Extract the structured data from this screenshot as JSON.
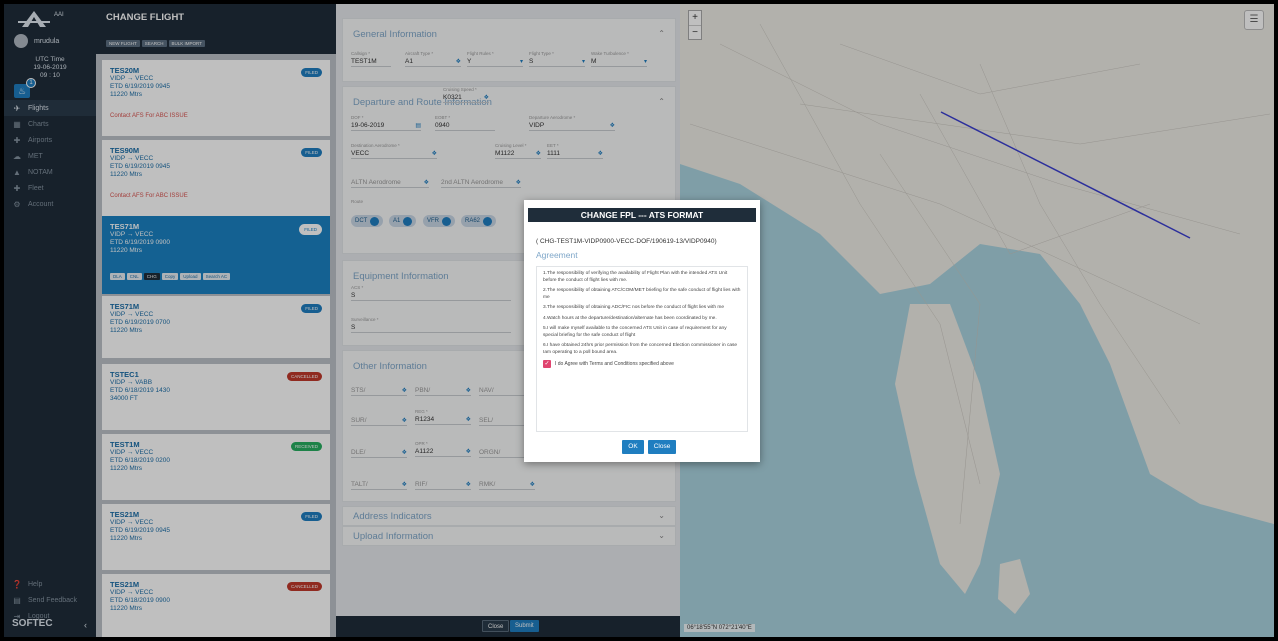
{
  "sidebar": {
    "logo_text": "AAI",
    "username": "mrudula",
    "utc_label": "UTC Time",
    "utc_date": "19-06-2019",
    "utc_time": "09 : 10",
    "notification_count": "1",
    "nav": [
      {
        "label": "Flights",
        "icon": "plane-icon"
      },
      {
        "label": "Charts",
        "icon": "chart-icon"
      },
      {
        "label": "Airports",
        "icon": "airport-icon"
      },
      {
        "label": "MET",
        "icon": "cloud-icon"
      },
      {
        "label": "NOTAM",
        "icon": "warning-icon"
      },
      {
        "label": "Fleet",
        "icon": "plane-icon"
      },
      {
        "label": "Account",
        "icon": "gear-icon"
      }
    ],
    "bottom": [
      {
        "label": "Help",
        "icon": "help-icon"
      },
      {
        "label": "Send Feedback",
        "icon": "feedback-icon"
      },
      {
        "label": "Logout",
        "icon": "logout-icon"
      }
    ],
    "brand": "SOFTEC"
  },
  "flights": {
    "title": "CHANGE FLIGHT",
    "header_buttons": [
      "NEW FLIGHT",
      "SEARCH",
      "BULK IMPORT"
    ],
    "cards": [
      {
        "id": "TES20M",
        "route": "VIDP → VECC",
        "etd": "ETD 6/19/2019 0945",
        "alt": "11220 Mtrs",
        "badge": "FILED",
        "note": "Contact AFS For ABC ISSUE"
      },
      {
        "id": "TES90M",
        "route": "VIDP → VECC",
        "etd": "ETD 6/19/2019 0945",
        "alt": "11220 Mtrs",
        "badge": "FILED",
        "note": "Contact AFS For ABC ISSUE"
      },
      {
        "id": "TES71M",
        "route": "VIDP → VECC",
        "etd": "ETD 6/19/2019 0900",
        "alt": "11220 Mtrs",
        "badge": "FILED",
        "actions": [
          "DLA",
          "CNL",
          "CHG",
          "Copy",
          "Upload",
          "Search AC"
        ]
      },
      {
        "id": "TES71M",
        "route": "VIDP → VECC",
        "etd": "ETD 6/19/2019 0700",
        "alt": "11220 Mtrs",
        "badge": "FILED"
      },
      {
        "id": "TSTEC1",
        "route": "VIDP → VABB",
        "etd": "ETD 6/18/2019 1430",
        "alt": "34000 FT",
        "badge": "CANCELLED"
      },
      {
        "id": "TEST1M",
        "route": "VIDP → VECC",
        "etd": "ETD 6/18/2019 0200",
        "alt": "11220 Mtrs",
        "badge": "RECEIVED"
      },
      {
        "id": "TES21M",
        "route": "VIDP → VECC",
        "etd": "ETD 6/19/2019 0945",
        "alt": "11220 Mtrs",
        "badge": "FILED"
      },
      {
        "id": "TES21M",
        "route": "VIDP → VECC",
        "etd": "ETD 6/18/2019 0900",
        "alt": "11220 Mtrs",
        "badge": "CANCELLED"
      }
    ]
  },
  "form": {
    "general": {
      "title": "General Information",
      "fields": [
        {
          "label": "Callsign *",
          "value": "TEST1M"
        },
        {
          "label": "Aircraft Type *",
          "value": "A1"
        },
        {
          "label": "Flight Rules *",
          "value": "Y"
        },
        {
          "label": "Flight Type *",
          "value": "S"
        },
        {
          "label": "Wake Turbulence *",
          "value": "M"
        }
      ]
    },
    "route": {
      "title": "Departure and Route Information",
      "dof_label": "DOF *",
      "dof": "19-06-2019",
      "eobt_label": "EOBT *",
      "eobt": "0940",
      "dep_label": "Departure Aerodrome *",
      "dep": "VIDP",
      "dest_label": "Destination Aerodrome *",
      "dest": "VECC",
      "speed_label": "Cruising Speed *",
      "speed": "K0321",
      "level_label": "Cruising Level *",
      "level": "M1122",
      "eet_label": "EET *",
      "eet": "1111",
      "altn_label": "ALTN Aerodrome",
      "altn2_label": "2nd ALTN Aerodrome",
      "route_label": "Route",
      "pills": [
        "DCT",
        "A1",
        "VFR",
        "RA62"
      ]
    },
    "equipment": {
      "title": "Equipment Information",
      "com_label": "ACS *",
      "com": "S",
      "surv_label": "Surveillance *",
      "surv": "S"
    },
    "other": {
      "title": "Other Information",
      "rows": [
        [
          {
            "label": "STS/",
            "value": ""
          },
          {
            "label": "PBN/",
            "value": ""
          },
          {
            "label": "NAV/",
            "value": ""
          }
        ],
        [
          {
            "label": "SUR/",
            "value": ""
          },
          {
            "label": "REG *",
            "value": "R1234"
          },
          {
            "label": "SEL/",
            "value": ""
          }
        ],
        [
          {
            "label": "DLE/",
            "value": ""
          },
          {
            "label": "OPR *",
            "value": "A1122"
          },
          {
            "label": "ORGN/",
            "value": ""
          }
        ],
        [
          {
            "label": "TALT/",
            "value": ""
          },
          {
            "label": "RIF/",
            "value": ""
          },
          {
            "label": "RMK/",
            "value": ""
          }
        ]
      ]
    },
    "address": {
      "title": "Address Indicators"
    },
    "upload": {
      "title": "Upload Information"
    },
    "footer": {
      "close": "Close",
      "submit": "Submit"
    }
  },
  "map": {
    "coords": "06°18'55\"N 072°21'40\"E",
    "zoom_in": "+",
    "zoom_out": "−",
    "route_points": [
      [
        0.44,
        0.17
      ],
      [
        0.86,
        0.37
      ]
    ]
  },
  "modal": {
    "title": "CHANGE FPL --- ATS FORMAT",
    "reference": "( CHG-TEST1M-VIDP0900-VECC-DOF/190619-13/VIDP0940)",
    "agreement_title": "Agreement",
    "terms": [
      "1.The responsibility of verifying the availability of Flight Plan with the intended ATS Unit before the conduct of flight lies with me.",
      "2.The responsibility of obtaining ATC/COM/MET briefing for the safe conduct of flight lies with me",
      "3.The responsibility of obtaining ADC/FIC nos before the conduct of flight lies with me",
      "4.Watch hours at the departure/destination/alternate has been coordinated by me.",
      "5.I will make myself available to the concerned ATS Unit in case of requirement for any special briefing for the safe conduct of flight",
      "6.I have obtained 24hrs prior permission from the concerned Election commissioner in case Iam operating to a poll bound area."
    ],
    "checkbox_label": "I do Agree with Terms and Conditions specified above",
    "ok_label": "OK",
    "close_label": "Close"
  }
}
